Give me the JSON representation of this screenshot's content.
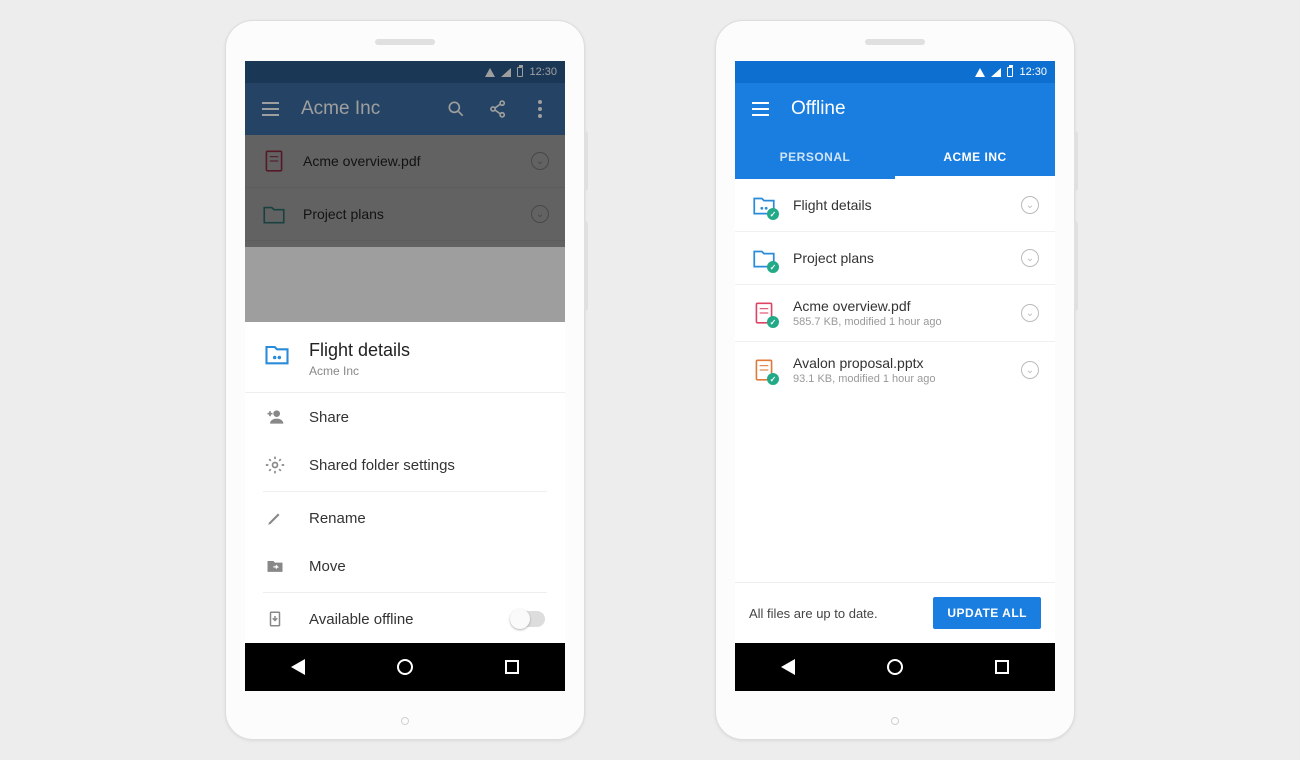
{
  "status": {
    "time": "12:30"
  },
  "left": {
    "appbar": {
      "title": "Acme Inc"
    },
    "rows": [
      {
        "name": "Acme overview.pdf"
      },
      {
        "name": "Project plans"
      }
    ],
    "sheet": {
      "title": "Flight details",
      "subtitle": "Acme Inc",
      "actions": {
        "share": "Share",
        "settings": "Shared folder settings",
        "rename": "Rename",
        "move": "Move",
        "offline": "Available offline"
      }
    }
  },
  "right": {
    "appbar": {
      "title": "Offline"
    },
    "tabs": {
      "personal": "PERSONAL",
      "acme": "ACME INC"
    },
    "rows": [
      {
        "name": "Flight details",
        "meta": ""
      },
      {
        "name": "Project plans",
        "meta": ""
      },
      {
        "name": "Acme overview.pdf",
        "meta": "585.7 KB, modified 1 hour ago"
      },
      {
        "name": "Avalon proposal.pptx",
        "meta": "93.1 KB, modified 1 hour ago"
      }
    ],
    "footer": {
      "status": "All files are up to date.",
      "button": "UPDATE ALL"
    }
  }
}
